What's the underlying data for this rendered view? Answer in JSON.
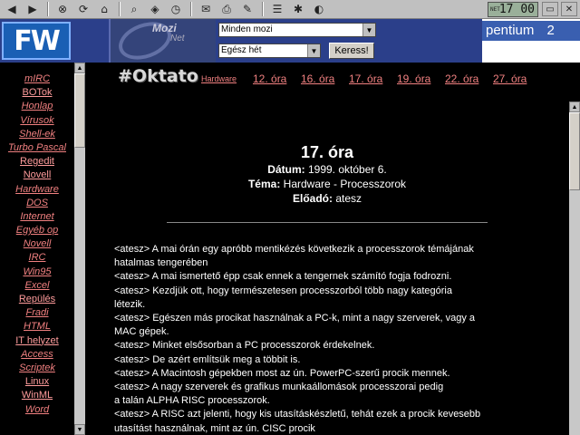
{
  "toolbar": {
    "icons": [
      "back-icon",
      "forward-icon",
      "stop-icon",
      "refresh-icon",
      "home-icon",
      "search-icon",
      "channels-icon",
      "history-icon",
      "mail-icon",
      "print-icon",
      "edit-icon",
      "discuss-icon",
      "favorites-icon",
      "media-icon"
    ],
    "clock": "17 00",
    "clock_net_label": "NET"
  },
  "banner": {
    "logo": "FW",
    "mozi_logo_top": "Mozi",
    "mozi_logo_bottom": "Net",
    "movie_select": "Minden mozi",
    "period_select": "Egész hét",
    "search_button": "Keress!",
    "ad_text": "pentium",
    "ad_suffix": "2"
  },
  "menu": {
    "items": [
      {
        "label": "mIRC",
        "style": "link"
      },
      {
        "label": "BOTok",
        "style": "plain"
      },
      {
        "label": "Honlap",
        "style": "link"
      },
      {
        "label": "Vírusok",
        "style": "link"
      },
      {
        "label": "Shell-ek",
        "style": "link"
      },
      {
        "label": "Turbo Pascal",
        "style": "link"
      },
      {
        "label": "Regedit",
        "style": "plain"
      },
      {
        "label": "Novell",
        "style": "plain"
      },
      {
        "label": "Hardware",
        "style": "link"
      },
      {
        "label": "DOS",
        "style": "link"
      },
      {
        "label": "Internet",
        "style": "link"
      },
      {
        "label": "Egyéb op",
        "style": "link"
      },
      {
        "label": "Novell",
        "style": "link"
      },
      {
        "label": "IRC",
        "style": "link"
      },
      {
        "label": "Win95",
        "style": "link"
      },
      {
        "label": "Excel",
        "style": "link"
      },
      {
        "label": "Repülés",
        "style": "plain"
      },
      {
        "label": "Fradi",
        "style": "link"
      },
      {
        "label": "HTML",
        "style": "link"
      },
      {
        "label": "IT helyzet",
        "style": "plain"
      },
      {
        "label": "Access",
        "style": "link"
      },
      {
        "label": "Scriptek",
        "style": "link"
      },
      {
        "label": "Linux",
        "style": "plain"
      },
      {
        "label": "WinML",
        "style": "plain"
      },
      {
        "label": "Word",
        "style": "link"
      }
    ]
  },
  "topnav": {
    "channel": "#Oktato",
    "links": [
      "Hardware",
      "12. óra",
      "16. óra",
      "17. óra",
      "19. óra",
      "22. óra",
      "27. óra"
    ]
  },
  "lesson": {
    "title": "17. óra",
    "date_label": "Dátum:",
    "date_value": "1999. október 6.",
    "topic_label": "Téma:",
    "topic_value": "Hardware - Processzorok",
    "presenter_label": "Előadó:",
    "presenter_value": "atesz",
    "lines": [
      "<atesz> A mai órán egy apróbb mentikézés következik a processzorok témájának",
      "hatalmas tengerében",
      " <atesz> A mai ismertető épp csak ennek a tengernek számító fogja fodrozni.",
      " <atesz> Kezdjük ott, hogy természetesen processzorból több nagy kategória",
      "létezik.",
      " <atesz> Egészen más procikat használnak a PC-k, mint a nagy szerverek, vagy a",
      "MAC gépek.",
      " <atesz> Minket elsősorban a PC processzorok érdekelnek.",
      " <atesz> De azért említsük meg a többit is.",
      " <atesz> A Macintosh gépekben most az ún. PowerPC-szerű procik mennek.",
      " <atesz> A nagy szerverek és grafikus munkaállomások processzorai pedig",
      "a talán ALPHA RISC processzorok.",
      " <atesz> A RISC azt jelenti, hogy kis utasításkészletű, tehát ezek a procik kevesebb",
      "utasítást használnak, mint az ún. CISC procik"
    ]
  }
}
